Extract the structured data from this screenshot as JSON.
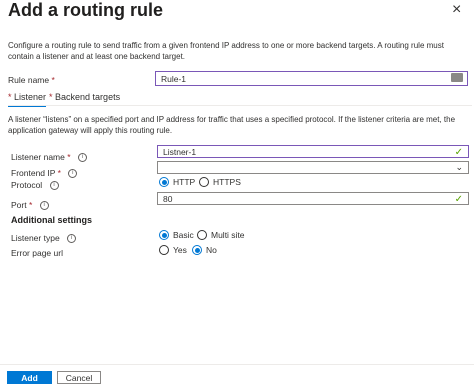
{
  "header": {
    "title": "Add a routing rule",
    "close_glyph": "×"
  },
  "description": "Configure a routing rule to send traffic from a given frontend IP address to one or more backend targets. A routing rule must contain a listener and at least one backend target.",
  "rule_name": {
    "label": "Rule name",
    "required": "*",
    "value": "Rule-1"
  },
  "tabs": [
    {
      "required": "*",
      "label": "Listener",
      "active": true
    },
    {
      "required": "*",
      "label": "Backend targets",
      "active": false
    }
  ],
  "listener_description": "A listener “listens” on a specified port and IP address for traffic that uses a specified protocol. If the listener criteria are met, the application gateway will apply this routing rule.",
  "listener_name": {
    "label": "Listener name",
    "required": "*",
    "value": "Listner-1",
    "info": "i"
  },
  "frontend_ip": {
    "label": "Frontend IP",
    "required": "*",
    "value": "",
    "info": "i"
  },
  "protocol": {
    "label": "Protocol",
    "info": "i",
    "options": [
      "HTTP",
      "HTTPS"
    ],
    "selected": "HTTP"
  },
  "port": {
    "label": "Port",
    "required": "*",
    "value": "80",
    "info": "i"
  },
  "additional_settings": {
    "title": "Additional settings"
  },
  "listener_type": {
    "label": "Listener type",
    "info": "i",
    "options": [
      "Basic",
      "Multi site"
    ],
    "selected": "Basic"
  },
  "error_page_url": {
    "label": "Error page url",
    "options": [
      "Yes",
      "No"
    ],
    "selected": "No"
  },
  "footer": {
    "add_label": "Add",
    "cancel_label": "Cancel"
  },
  "colors": {
    "accent": "#0078d4",
    "valid": "#57a300",
    "required": "#a4262c",
    "focus": "#7a57b7"
  },
  "icons": {
    "close": "close-icon",
    "valid": "checkmark-icon",
    "dropdown": "chevron-down-icon",
    "info": "info-icon",
    "autofill": "autofill-card-icon"
  }
}
